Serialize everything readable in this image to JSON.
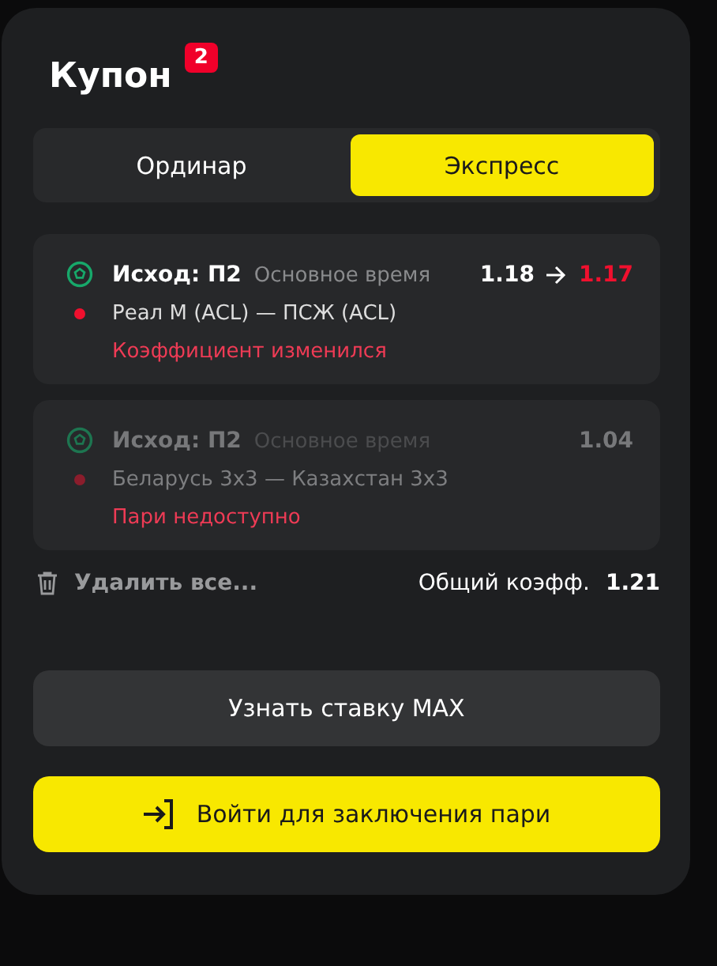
{
  "coupon": {
    "title": "Купон",
    "count": "2"
  },
  "tabs": [
    {
      "label": "Ординар",
      "selected": false
    },
    {
      "label": "Экспресс",
      "selected": true
    }
  ],
  "bets": [
    {
      "outcome": "Исход: П2",
      "period": "Основное время",
      "odds": "1.18",
      "new_odds": "1.17",
      "match": "Реал М (ACL) — ПСЖ (ACL)",
      "status": "Коэффициент изменился",
      "disabled": false
    },
    {
      "outcome": "Исход: П2",
      "period": "Основное время",
      "odds": "1.04",
      "match": "Беларусь 3x3 — Казахстан 3x3",
      "status": "Пари недоступно",
      "disabled": true
    }
  ],
  "footer": {
    "delete_all": "Удалить все...",
    "total_label": "Общий коэфф.",
    "total_value": "1.21"
  },
  "buttons": {
    "max_stake": "Узнать ставку MAX",
    "login": "Войти для заключения пари"
  }
}
